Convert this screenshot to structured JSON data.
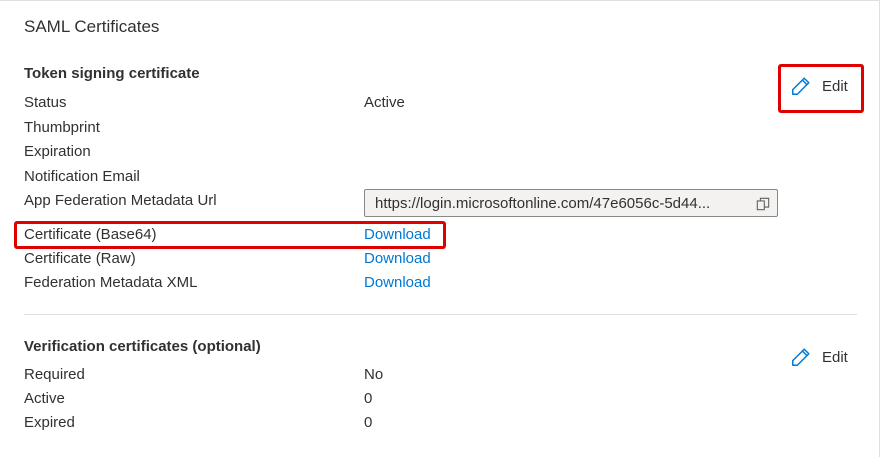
{
  "section_title": "SAML Certificates",
  "token_signing": {
    "title": "Token signing certificate",
    "edit_label": "Edit",
    "rows": {
      "status": {
        "label": "Status",
        "value": "Active"
      },
      "thumbprint": {
        "label": "Thumbprint",
        "value": ""
      },
      "expiration": {
        "label": "Expiration",
        "value": ""
      },
      "notification_email": {
        "label": "Notification Email",
        "value": ""
      },
      "metadata_url": {
        "label": "App Federation Metadata Url",
        "value": "https://login.microsoftonline.com/47e6056c-5d44..."
      },
      "cert_base64": {
        "label": "Certificate (Base64)",
        "link": "Download"
      },
      "cert_raw": {
        "label": "Certificate (Raw)",
        "link": "Download"
      },
      "federation_xml": {
        "label": "Federation Metadata XML",
        "link": "Download"
      }
    }
  },
  "verification": {
    "title": "Verification certificates (optional)",
    "edit_label": "Edit",
    "rows": {
      "required": {
        "label": "Required",
        "value": "No"
      },
      "active": {
        "label": "Active",
        "value": "0"
      },
      "expired": {
        "label": "Expired",
        "value": "0"
      }
    }
  },
  "icons": {
    "edit": "pencil-icon",
    "copy": "copy-icon"
  },
  "colors": {
    "link": "#0078d4",
    "highlight": "#e00000",
    "icon": "#0078d4"
  }
}
